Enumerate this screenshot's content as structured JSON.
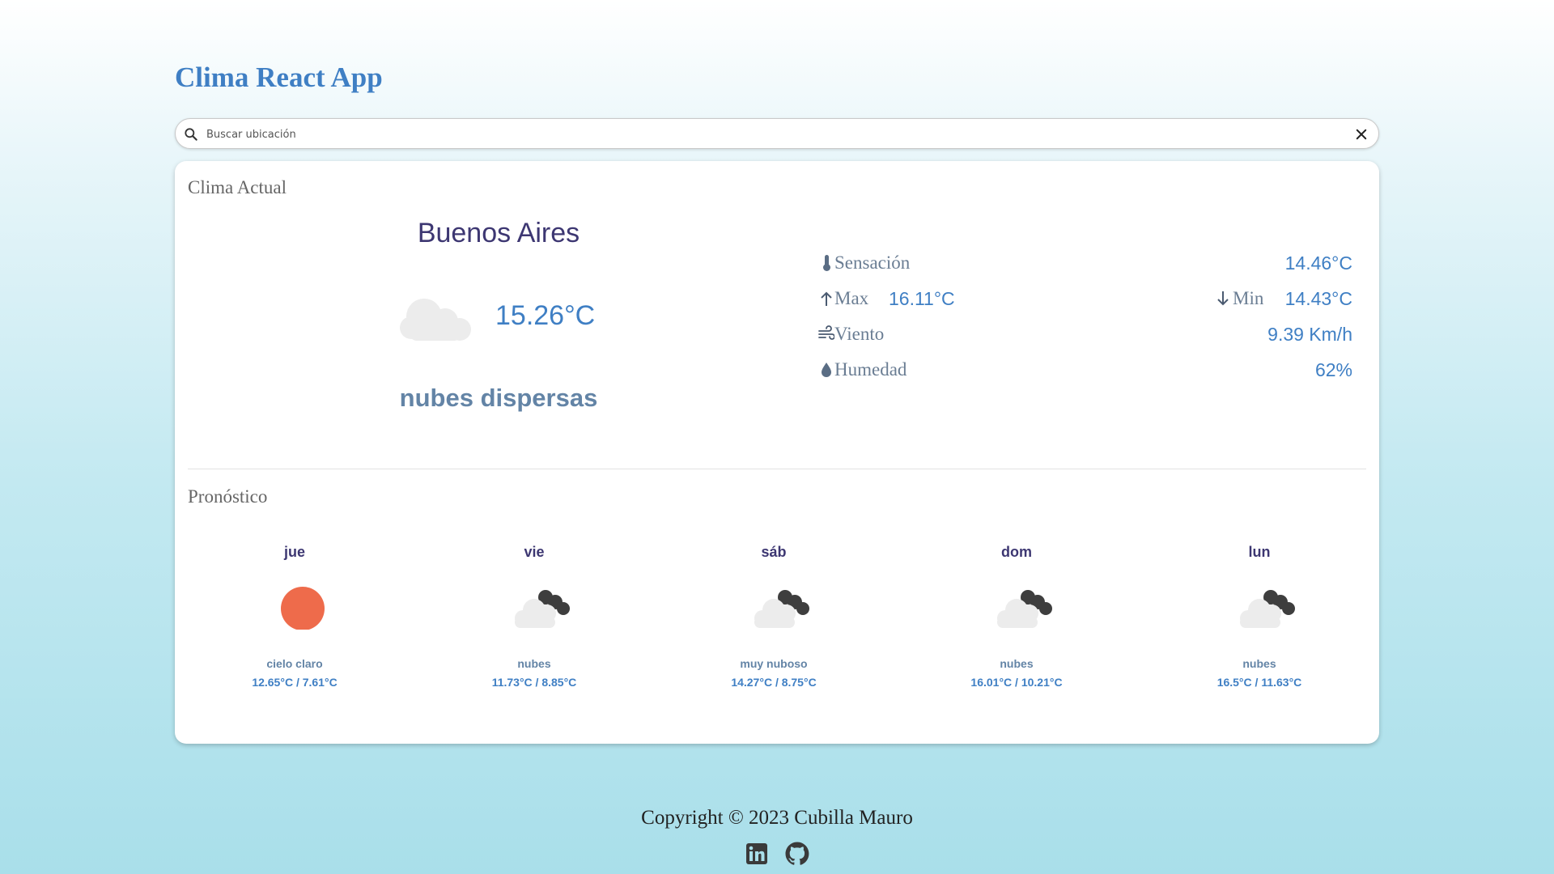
{
  "app": {
    "title": "Clima React App"
  },
  "search": {
    "placeholder": "Buscar ubicación",
    "value": ""
  },
  "current": {
    "section_title": "Clima Actual",
    "city": "Buenos Aires",
    "temp": "15.26°C",
    "description": "nubes dispersas",
    "icon": "cloud-icon"
  },
  "stats": {
    "sensacion": {
      "label": "Sensación",
      "value": "14.46°C"
    },
    "max": {
      "label": "Max",
      "value": "16.11°C"
    },
    "min": {
      "label": "Min",
      "value": "14.43°C"
    },
    "viento": {
      "label": "Viento",
      "value": "9.39 Km/h"
    },
    "humedad": {
      "label": "Humedad",
      "value": "62%"
    }
  },
  "forecast": {
    "section_title": "Pronóstico",
    "days": [
      {
        "day": "jue",
        "desc": "cielo claro",
        "temps": "12.65°C / 7.61°C",
        "icon": "sun-icon"
      },
      {
        "day": "vie",
        "desc": "nubes",
        "temps": "11.73°C / 8.85°C",
        "icon": "cloudy-icon"
      },
      {
        "day": "sáb",
        "desc": "muy nuboso",
        "temps": "14.27°C / 8.75°C",
        "icon": "cloudy-icon"
      },
      {
        "day": "dom",
        "desc": "nubes",
        "temps": "16.01°C / 10.21°C",
        "icon": "cloudy-icon"
      },
      {
        "day": "lun",
        "desc": "nubes",
        "temps": "16.5°C / 11.63°C",
        "icon": "cloudy-icon"
      }
    ]
  },
  "footer": {
    "copyright": "Copyright © 2023 Cubilla Mauro"
  },
  "colors": {
    "accent": "#3f7fc4",
    "city": "#3d3772",
    "sun": "#ee6b4b"
  }
}
